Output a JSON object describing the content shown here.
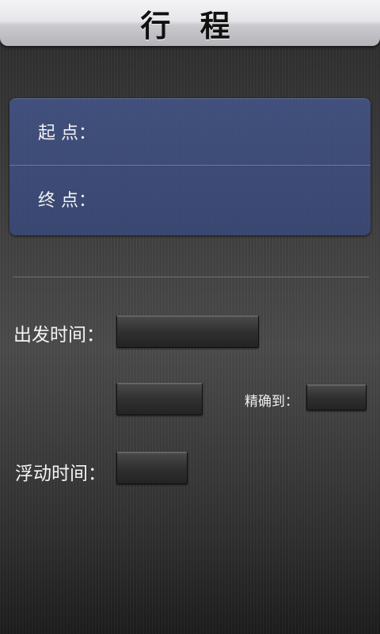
{
  "header": {
    "title": "行 程"
  },
  "route": {
    "start_label": "起 点：",
    "end_label": "终 点："
  },
  "form": {
    "departure_time_label": "出发时间：",
    "departure_date_value": "",
    "departure_time_value": "",
    "precision_label": "精确到：",
    "precision_value": "",
    "float_time_label": "浮动时间：",
    "float_time_value": ""
  }
}
